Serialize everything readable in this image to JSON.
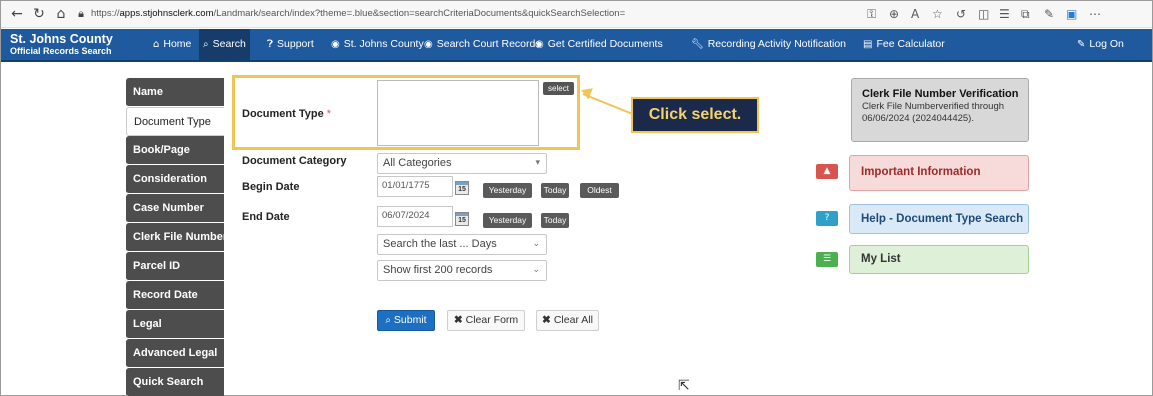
{
  "browser": {
    "url_prefix": "https://",
    "url_host": "apps.stjohnsclerk.com",
    "url_path": "/Landmark/search/index?theme=.blue&section=searchCriteriaDocuments&quickSearchSelection="
  },
  "site": {
    "title": "St. Johns County",
    "subtitle": "Official Records Search"
  },
  "nav": {
    "home": "Home",
    "search": "Search",
    "support": "Support",
    "county": "St. Johns County",
    "court": "Search Court Records",
    "certified": "Get Certified Documents",
    "recording": "Recording Activity Notification",
    "fee": "Fee Calculator",
    "logon": "Log On"
  },
  "tabs": [
    "Name",
    "Document Type",
    "Book/Page",
    "Consideration",
    "Case Number",
    "Clerk File Number",
    "Parcel ID",
    "Record Date",
    "Legal",
    "Advanced Legal",
    "Quick Search"
  ],
  "active_tab": "Document Type",
  "form": {
    "doc_type_label": "Document Type",
    "required_mark": "*",
    "select_label": "select",
    "category_label": "Document Category",
    "category_value": "All Categories",
    "begin_label": "Begin Date",
    "begin_value": "01/01/1775",
    "end_label": "End Date",
    "end_value": "06/07/2024",
    "cal_text": "15",
    "yesterday": "Yesterday",
    "today": "Today",
    "oldest": "Oldest",
    "days_placeholder": "Search the last ... Days",
    "records_value": "Show first 200 records",
    "submit": "Submit",
    "clear_form": "Clear Form",
    "clear_all": "Clear All"
  },
  "callout": "Click select.",
  "side": {
    "verify_title": "Clerk File Number Verification",
    "verify_detail": "Clerk File Numberverified through 06/06/2024 (2024044425).",
    "important": "Important Information",
    "help": "Help - Document Type Search",
    "mylist": "My List"
  },
  "colors": {
    "nav_bg": "#1f5a9e",
    "highlight": "#f0c555",
    "important_bg": "#f7dada",
    "help_bg": "#d9e9f7",
    "mylist_bg": "#dff0d8"
  }
}
